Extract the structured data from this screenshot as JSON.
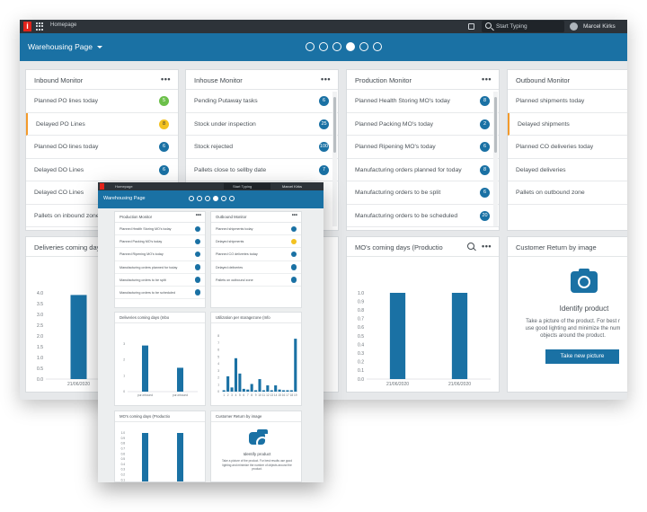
{
  "topbar": {
    "app": "Homepage",
    "search_placeholder": "Start Typing",
    "user": "Marcel Kirks"
  },
  "page": {
    "title": "Warehousing Page",
    "pager": {
      "count": 6,
      "active": 3
    }
  },
  "monitors": [
    {
      "title": "Inbound Monitor",
      "rows": [
        {
          "label": "Planned PO lines today",
          "badge": "5",
          "color": "green"
        },
        {
          "label": "Delayed PO Lines",
          "badge": "8",
          "color": "yellow",
          "selected": true
        },
        {
          "label": "Planned DO lines today",
          "badge": "6",
          "color": "blue"
        },
        {
          "label": "Delayed DO Lines",
          "badge": "6",
          "color": "blue"
        },
        {
          "label": "Delayed CO Lines",
          "badge": "",
          "color": ""
        },
        {
          "label": "Pallets on inbound zone",
          "badge": "",
          "color": ""
        }
      ]
    },
    {
      "title": "Inhouse Monitor",
      "rows": [
        {
          "label": "Pending Putaway tasks",
          "badge": "6",
          "color": "blue"
        },
        {
          "label": "Stock under inspection",
          "badge": "25",
          "color": "blue"
        },
        {
          "label": "Stock rejected",
          "badge": "100",
          "color": "blue"
        },
        {
          "label": "Pallets close to sellby date",
          "badge": "7",
          "color": "blue"
        }
      ]
    },
    {
      "title": "Production Monitor",
      "rows": [
        {
          "label": "Planned Health Storing MO's today",
          "badge": "8",
          "color": "blue"
        },
        {
          "label": "Planned Packing MO's today",
          "badge": "2",
          "color": "blue"
        },
        {
          "label": "Planned Ripening MO's today",
          "badge": "6",
          "color": "blue"
        },
        {
          "label": "Manufacturing orders planned for today",
          "badge": "8",
          "color": "blue"
        },
        {
          "label": "Manufacturing orders to be split",
          "badge": "6",
          "color": "blue"
        },
        {
          "label": "Manufacturing orders to be scheduled",
          "badge": "20",
          "color": "blue"
        }
      ]
    },
    {
      "title": "Outbound Monitor",
      "rows": [
        {
          "label": "Planned shipments today",
          "badge": "",
          "color": ""
        },
        {
          "label": "Delayed shipments",
          "badge": "",
          "color": "",
          "selected": true
        },
        {
          "label": "Planned CO deliveries today",
          "badge": "",
          "color": ""
        },
        {
          "label": "Delayed deliveries",
          "badge": "",
          "color": ""
        },
        {
          "label": "Pallets on outbound zone",
          "badge": "",
          "color": ""
        }
      ]
    }
  ],
  "deliveries_card": {
    "title": "Deliveries coming days"
  },
  "mos_card": {
    "title": "MO's coming days (Productio"
  },
  "customer_return": {
    "title": "Customer Return by image",
    "heading": "Identify product",
    "description_1": "Take a picture of the product. For best r",
    "description_2": "use good lighting and minimize the num",
    "description_3": "objects around the product.",
    "button": "Take new picture"
  },
  "chart_data": [
    {
      "type": "bar",
      "title": "Deliveries coming days",
      "yticks": [
        "4.0",
        "3.5",
        "3.0",
        "2.5",
        "2.0",
        "1.5",
        "1.0",
        "0.5",
        "0.0"
      ],
      "ylim": [
        0,
        4
      ],
      "categories": [
        "21/06/2020"
      ],
      "values": [
        3.9
      ]
    },
    {
      "type": "bar",
      "title": "MO's coming days (Productio",
      "yticks": [
        "1.0",
        "0.9",
        "0.8",
        "0.7",
        "0.6",
        "0.5",
        "0.4",
        "0.3",
        "0.2",
        "0.1",
        "0.0"
      ],
      "ylim": [
        0,
        1
      ],
      "categories": [
        "21/06/2020",
        "21/06/2020"
      ],
      "values": [
        1.0,
        1.0
      ]
    },
    {
      "type": "bar",
      "title": "Deliveries coming days (Inbo",
      "yticks": [
        "3",
        "2",
        "1",
        "0"
      ],
      "ylim": [
        0,
        3.5
      ],
      "categories": [
        "pur-inbound",
        "pur-inbound"
      ],
      "values": [
        2.9,
        1.5
      ]
    },
    {
      "type": "bar",
      "title": "Utilization per storagezone (Info",
      "yticks": [
        "0",
        "1",
        "2",
        "3",
        "4",
        "5",
        "6",
        "7",
        "8"
      ],
      "ylim": [
        0,
        8
      ],
      "categories": [
        "1",
        "2",
        "3",
        "4",
        "5",
        "6",
        "7",
        "8",
        "9",
        "10",
        "11",
        "12",
        "13",
        "14",
        "15",
        "16",
        "17",
        "18",
        "19"
      ],
      "values": [
        0.2,
        2.2,
        0.6,
        4.8,
        2.6,
        0.4,
        0.3,
        1.1,
        0.2,
        1.8,
        0.2,
        0.9,
        0.2,
        0.9,
        0.3,
        0.2,
        0.2,
        0.2,
        7.6
      ]
    },
    {
      "type": "bar",
      "title": "MO's coming days (Productio",
      "yticks": [
        "1.0",
        "0.9",
        "0.8",
        "0.7",
        "0.6",
        "0.5",
        "0.4",
        "0.3",
        "0.2",
        "0.1",
        "0.0"
      ],
      "ylim": [
        0,
        1
      ],
      "categories": [
        "",
        ""
      ],
      "values": [
        1.0,
        1.0
      ]
    }
  ],
  "overlay": {
    "app": "Homepage",
    "search": "Start Typing",
    "user": "Marcel Kirks",
    "page_title": "Warehousing Page",
    "production": {
      "title": "Production Monitor",
      "rows": [
        "Planned Health Storing MO's today",
        "Planned Packing MO's today",
        "Planned Ripening MO's today",
        "Manufacturing orders planned for today",
        "Manufacturing orders to be split",
        "Manufacturing orders to be scheduled"
      ]
    },
    "outbound": {
      "title": "Outbound Monitor",
      "rows": [
        "Planned shipments today",
        "Delayed shipments",
        "Planned CO deliveries today",
        "Delayed deliveries",
        "Pallets on outbound zone"
      ]
    },
    "deliveries_title": "Deliveries coming days (Inbo",
    "utilization_title": "Utilization per storagezone (Info",
    "mos_title": "MO's coming days (Productio",
    "return_title": "Customer Return by image",
    "return_heading": "Identify product",
    "return_desc": "Take a picture of the product. For best results use good lighting and minimize the number of objects around the product."
  }
}
